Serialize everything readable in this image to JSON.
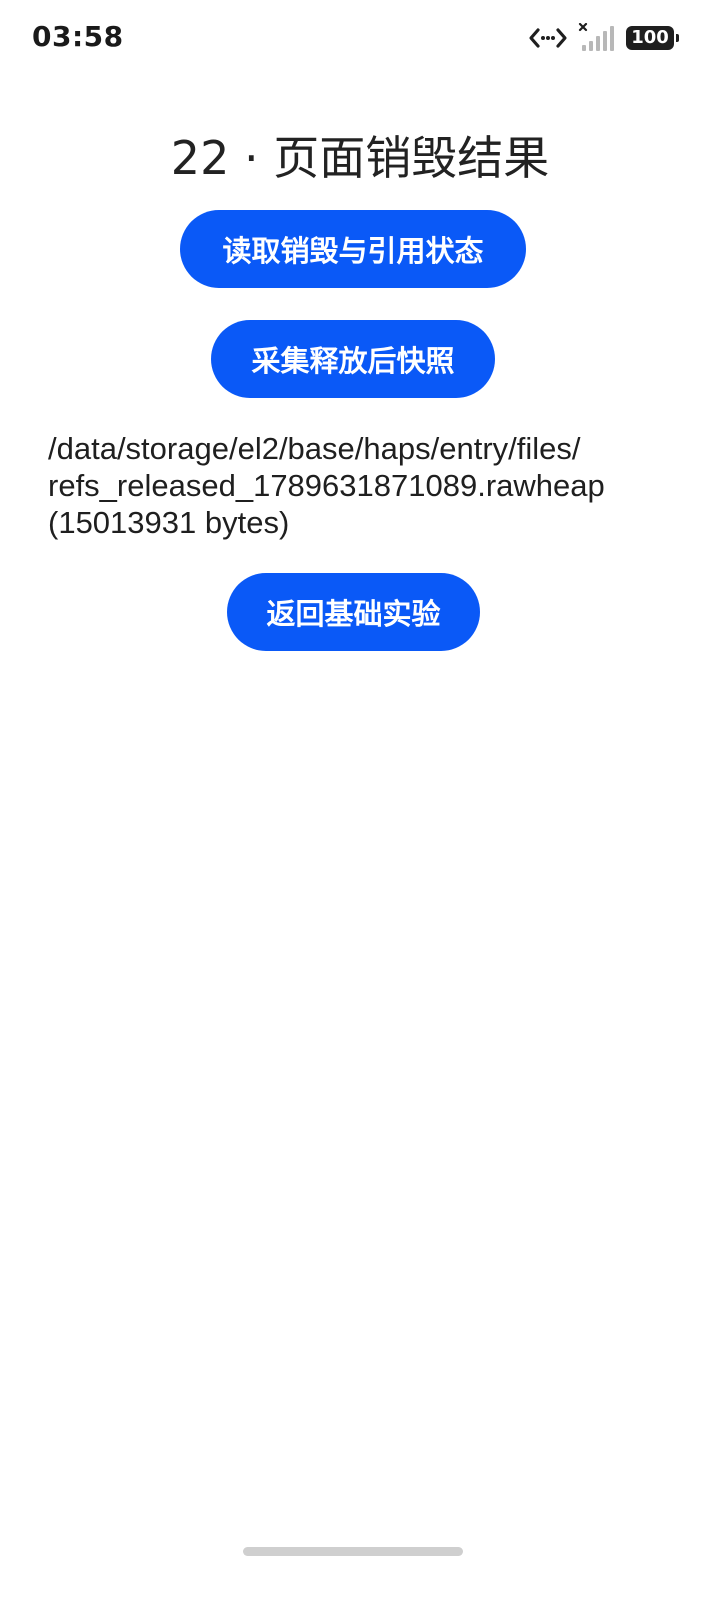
{
  "status_bar": {
    "time": "03:58",
    "battery_level": "100",
    "icons": [
      "data-transfer-icon",
      "no-signal-icon",
      "battery-icon"
    ]
  },
  "page": {
    "title": "22 · 页面销毁结果"
  },
  "buttons": {
    "read_status": "读取销毁与引用状态",
    "collect_snapshot": "采集释放后快照",
    "back_to_basics": "返回基础实验"
  },
  "result": {
    "text": "/data/storage/el2/base/haps/entry/files/\nrefs_released_1789631871089.rawheap\n(15013931 bytes)"
  },
  "colors": {
    "accent": "#0a59f7",
    "background": "#ffffff",
    "text": "#1f1f1f"
  }
}
